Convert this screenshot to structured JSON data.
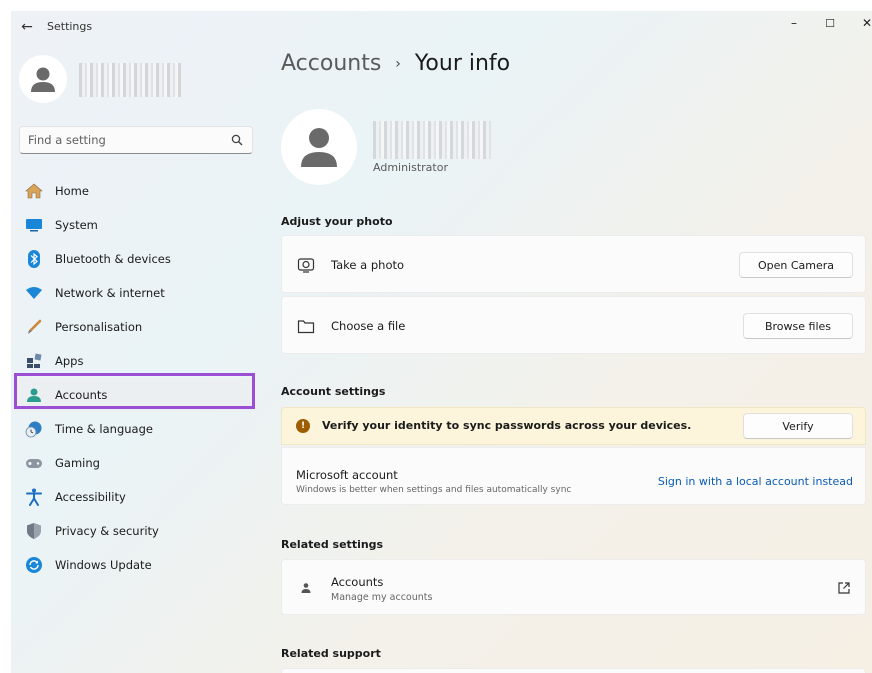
{
  "window": {
    "title": "Settings",
    "back_glyph": "←",
    "minimize_glyph": "–",
    "maximize_glyph": "☐",
    "close_glyph": "✕"
  },
  "sidebar": {
    "search_placeholder": "Find a setting",
    "items": [
      {
        "label": "Home",
        "icon": "home-icon"
      },
      {
        "label": "System",
        "icon": "system-icon"
      },
      {
        "label": "Bluetooth & devices",
        "icon": "bluetooth-icon"
      },
      {
        "label": "Network & internet",
        "icon": "network-icon"
      },
      {
        "label": "Personalisation",
        "icon": "brush-icon"
      },
      {
        "label": "Apps",
        "icon": "apps-icon"
      },
      {
        "label": "Accounts",
        "icon": "accounts-icon",
        "active": true
      },
      {
        "label": "Time & language",
        "icon": "time-language-icon"
      },
      {
        "label": "Gaming",
        "icon": "gaming-icon"
      },
      {
        "label": "Accessibility",
        "icon": "accessibility-icon"
      },
      {
        "label": "Privacy & security",
        "icon": "shield-icon"
      },
      {
        "label": "Windows Update",
        "icon": "update-icon"
      }
    ]
  },
  "main": {
    "breadcrumb_parent": "Accounts",
    "breadcrumb_sep": "›",
    "breadcrumb_current": "Your info",
    "user_role": "Administrator",
    "adjust_photo": {
      "heading": "Adjust your photo",
      "take_photo_label": "Take a photo",
      "open_camera_button": "Open Camera",
      "choose_file_label": "Choose a file",
      "browse_files_button": "Browse files"
    },
    "account_settings": {
      "heading": "Account settings",
      "warning_glyph": "!",
      "warning_text": "Verify your identity to sync passwords across your devices.",
      "verify_button": "Verify",
      "ms_account_title": "Microsoft account",
      "ms_account_sub": "Windows is better when settings and files automatically sync",
      "ms_account_link": "Sign in with a local account instead"
    },
    "related_settings": {
      "heading": "Related settings",
      "accounts_title": "Accounts",
      "accounts_sub": "Manage my accounts"
    },
    "related_support": {
      "heading": "Related support"
    }
  },
  "colors": {
    "accent_link": "#0a5bb5",
    "highlight_outline": "#9b4fd4",
    "warning_bg": "#fcf5dc",
    "warning_icon": "#9d5d00"
  }
}
